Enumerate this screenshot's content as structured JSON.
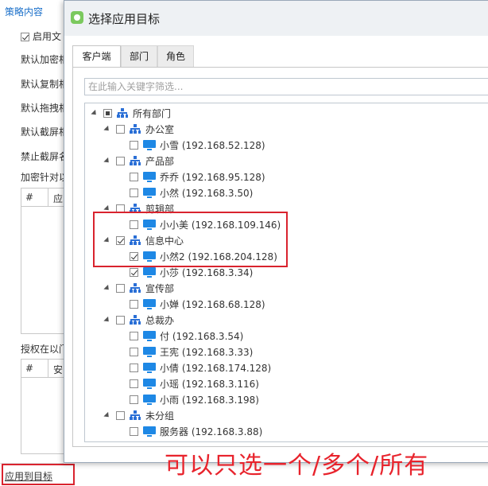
{
  "background": {
    "section_title": "策略内容",
    "enable_label": "启用文",
    "labels": [
      "默认加密相",
      "默认复制相",
      "默认拖拽相",
      "默认截屏相",
      "禁止截屏名",
      "加密针对以"
    ],
    "table1_headers": [
      "#",
      "应"
    ],
    "authorize_label": "授权在以门",
    "table2_headers": [
      "#",
      "安"
    ],
    "apply_label": "应用到目标"
  },
  "dialog": {
    "title": "选择应用目标",
    "tabs": [
      "客户端",
      "部门",
      "角色"
    ],
    "filter_placeholder": "在此输入关键字筛选...",
    "root_label": "所有部门",
    "groups": [
      {
        "name": "办公室",
        "checked": false,
        "clients": [
          {
            "label": "小雪 (192.168.52.128)",
            "checked": false
          }
        ]
      },
      {
        "name": "产品部",
        "checked": false,
        "clients": [
          {
            "label": "乔乔 (192.168.95.128)",
            "checked": false
          },
          {
            "label": "小然 (192.168.3.50)",
            "checked": false
          }
        ]
      },
      {
        "name": "剪辑部",
        "checked": false,
        "clients": [
          {
            "label": "小小美 (192.168.109.146)",
            "checked": false
          }
        ]
      },
      {
        "name": "信息中心",
        "checked": true,
        "clients": [
          {
            "label": "小然2 (192.168.204.128)",
            "checked": true
          },
          {
            "label": "小莎 (192.168.3.34)",
            "checked": true
          }
        ]
      },
      {
        "name": "宣传部",
        "checked": false,
        "clients": [
          {
            "label": "小婵 (192.168.68.128)",
            "checked": false
          }
        ]
      },
      {
        "name": "总裁办",
        "checked": false,
        "clients": [
          {
            "label": "付 (192.168.3.54)",
            "checked": false
          },
          {
            "label": "王宪 (192.168.3.33)",
            "checked": false
          },
          {
            "label": "小倩 (192.168.174.128)",
            "checked": false
          },
          {
            "label": "小瑶 (192.168.3.116)",
            "checked": false
          },
          {
            "label": "小雨 (192.168.3.198)",
            "checked": false
          }
        ]
      },
      {
        "name": "未分组",
        "checked": false,
        "clients": [
          {
            "label": "服务器 (192.168.3.88)",
            "checked": false
          }
        ]
      }
    ]
  },
  "caption": "可以只选一个/多个/所有",
  "colors": {
    "accent": "#1a6fc9",
    "annotation_red": "#d9232e",
    "pc_icon": "#1e88e5",
    "org_icon": "#2a6fd6"
  }
}
